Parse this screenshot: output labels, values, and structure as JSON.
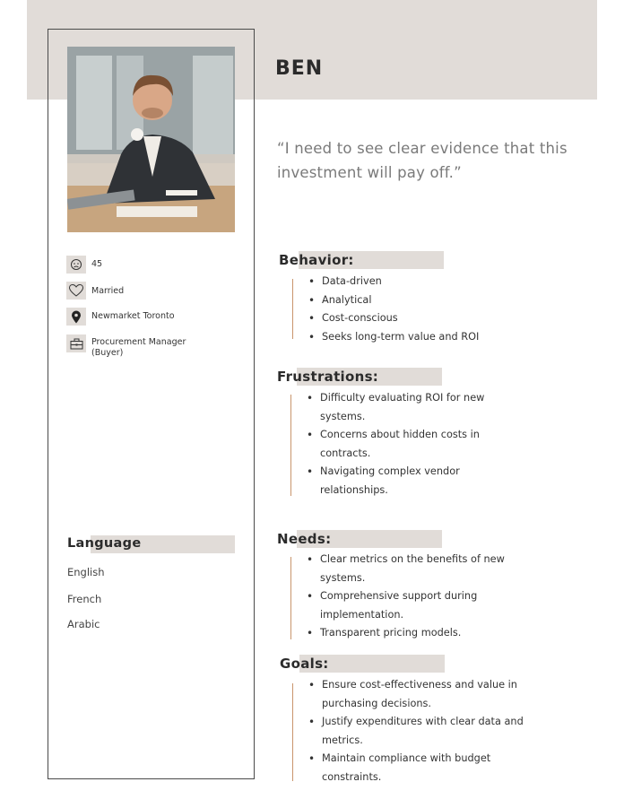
{
  "persona": {
    "name": "BEN",
    "quote": "“I need to see clear evidence that this investment will pay off.”"
  },
  "info": {
    "age": "45",
    "status": "Married",
    "location": "Newmarket Toronto",
    "occupation": "Procurement  Manager (Buyer)"
  },
  "language": {
    "title": "Language",
    "items": [
      "English",
      "French",
      "Arabic"
    ]
  },
  "behavior": {
    "title": "Behavior:",
    "items": [
      "Data-driven",
      "Analytical",
      "Cost-conscious",
      "Seeks long-term value and ROI"
    ]
  },
  "frustrations": {
    "title": "Frustrations:",
    "items": [
      "Difficulty evaluating ROI for new systems.",
      "Concerns about hidden costs in contracts.",
      "Navigating complex vendor relationships."
    ]
  },
  "needs": {
    "title": "Needs:",
    "items": [
      "Clear metrics on the benefits of new systems.",
      "Comprehensive support during implementation.",
      "Transparent pricing models."
    ]
  },
  "goals": {
    "title": "Goals:",
    "items": [
      "Ensure cost-effectiveness and value in purchasing decisions.",
      "Justify expenditures with clear data and metrics.",
      "Maintain compliance with budget constraints."
    ]
  },
  "colors": {
    "band": "#e1dcd8",
    "accent_line": "#c9956c",
    "text": "#333333"
  }
}
